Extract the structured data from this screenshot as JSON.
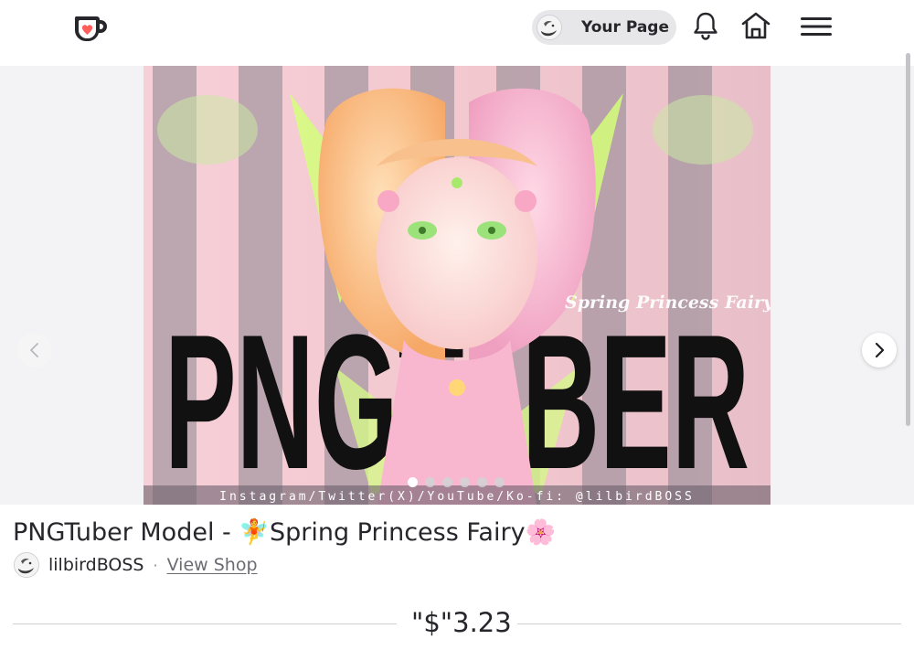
{
  "header": {
    "your_page_label": "Your Page"
  },
  "gallery": {
    "image_text_big": "PNGTuBER",
    "image_text_script": "Spring Princess Fairy",
    "image_caption": "Instagram/Twitter(X)/YouTube/Ko-fi: @lilbirdBOSS",
    "slide_count": 6,
    "active_slide": 1
  },
  "product": {
    "title": "PNGTuber Model - 🧚Spring Princess Fairy🌸",
    "seller_name": "lilbirdBOSS",
    "separator": "·",
    "view_shop_label": "View Shop",
    "price": "\"$\"3.23"
  },
  "colors": {
    "kofi_red": "#ff5e5b",
    "text": "#26262b",
    "pill_bg": "#e7e7ea"
  }
}
